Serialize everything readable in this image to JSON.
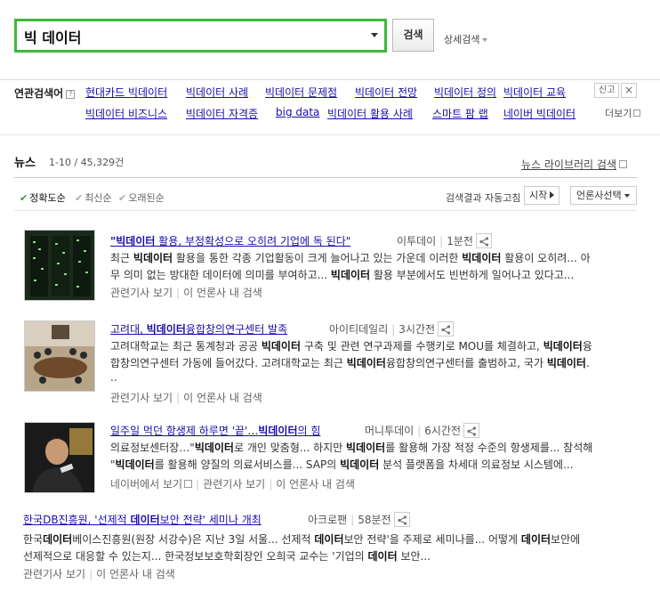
{
  "search": {
    "query": "빅 데이터",
    "button_label": "검색",
    "advanced_label": "상세검색"
  },
  "related": {
    "title": "연관검색어",
    "help": "?",
    "row1": [
      "현대카드 빅데이터",
      "빅데이터 사례",
      "빅데이터 문제점",
      "빅데이터 전망",
      "빅데이터 정의",
      "빅데이터 교육"
    ],
    "row2": [
      "빅데이터 비즈니스",
      "빅데이터 자격증",
      "big data",
      "빅데이터 활용 사례",
      "스마트 팜 랩",
      "네이버 빅데이터"
    ],
    "report_label": "신고",
    "close_label": "×",
    "more_label": "더보기"
  },
  "news": {
    "title": "뉴스",
    "count": "1-10 / 45,329건",
    "library_label": "뉴스 라이브러리 검색"
  },
  "sort": {
    "accuracy": "정확도순",
    "latest": "최신순",
    "oldest": "오래된순",
    "auto_refresh": "검색결과 자동고침",
    "start": "시작",
    "press_select": "언론사선택"
  },
  "articles": [
    {
      "title_pre": "",
      "title_bold": "\"빅데이터",
      "title_post": " 활용, 부정확성으로 오히려 기업에 독 된다\"",
      "press": "이투데이",
      "time": "1분전",
      "snippet1_a": "최근 ",
      "snippet1_b": "빅데이터",
      "snippet1_c": " 활용을 통한 각종 기업활동이 크게 늘어나고 있는 가운데 이러한 ",
      "snippet1_d": "빅데이터",
      "snippet1_e": " 활용이 오히려... 아",
      "snippet2_a": "무 의미 없는 방대한 데이터에 의미를 부여하고... ",
      "snippet2_b": "빅데이터",
      "snippet2_c": " 활용 부분에서도 빈번하게 일어나고 있다고...",
      "meta1": "관련기사 보기",
      "meta2": "이 언론사 내 검색"
    },
    {
      "title_pre": "고려대, ",
      "title_bold": "빅데이터",
      "title_post": "융합창의연구센터 발족",
      "press": "아이티데일리",
      "time": "3시간전",
      "snippet1_a": "고려대학교는 최근 통계청과 공공 ",
      "snippet1_b": "빅데이터",
      "snippet1_c": " 구축 및 관련 연구과제를 수행키로 MOU를 체결하고, ",
      "snippet1_d": "빅데이터",
      "snippet1_e": "융",
      "snippet2_a": "합창의연구센터 가동에 들어갔다. 고려대학교는 최근 ",
      "snippet2_b": "빅데이터",
      "snippet2_c": "융합창의연구센터를 출범하고, 국가 ",
      "snippet2_d": "빅데이터",
      "snippet2_e": ".",
      "snippet3": "..",
      "meta1": "관련기사 보기",
      "meta2": "이 언론사 내 검색"
    },
    {
      "title_pre": "일주일 먹던 항생제 하루면 '끝'…",
      "title_bold": "빅데이터",
      "title_post": "의 힘",
      "press": "머니투데이",
      "time": "6시간전",
      "snippet1_a": "의료정보센터장…\"",
      "snippet1_b": "빅데이터",
      "snippet1_c": "로 개인 맞춤형... 하지만 ",
      "snippet1_d": "빅데이터",
      "snippet1_e": "를 활용해 가장 적정 수준의 항생제를... 참석해",
      "snippet2_a": "\"",
      "snippet2_b": "빅데이터",
      "snippet2_c": "를 활용해 양질의 의료서비스를... SAP의 ",
      "snippet2_d": "빅데이터",
      "snippet2_e": " 분석 플랫폼을 차세대 의료정보 시스템에...",
      "meta0": "네이버에서 보기",
      "meta1": "관련기사 보기",
      "meta2": "이 언론사 내 검색"
    },
    {
      "title_pre": "한국DB진흥원, '선제적 ",
      "title_bold": "데이터",
      "title_post": "보안 전략' 세미나 개최",
      "press": "아크로팬",
      "time": "58분전",
      "snippet1_a": "한국",
      "snippet1_b": "데이터",
      "snippet1_c": "베이스진흥원(원장 서강수)은 지난 3일 서울... 선제적 ",
      "snippet1_d": "데이터",
      "snippet1_e": "보안 전략'을 주제로 세미나를... 어떻게 ",
      "snippet1_f": "데이터",
      "snippet1_g": "보안에",
      "snippet2_a": "선제적으로 대응할 수 있는지... 한국정보보호학회장인 오희국 교수는 '기업의 ",
      "snippet2_b": "데이터",
      "snippet2_c": " 보안...",
      "meta1": "관련기사 보기",
      "meta2": "이 언론사 내 검색"
    }
  ]
}
